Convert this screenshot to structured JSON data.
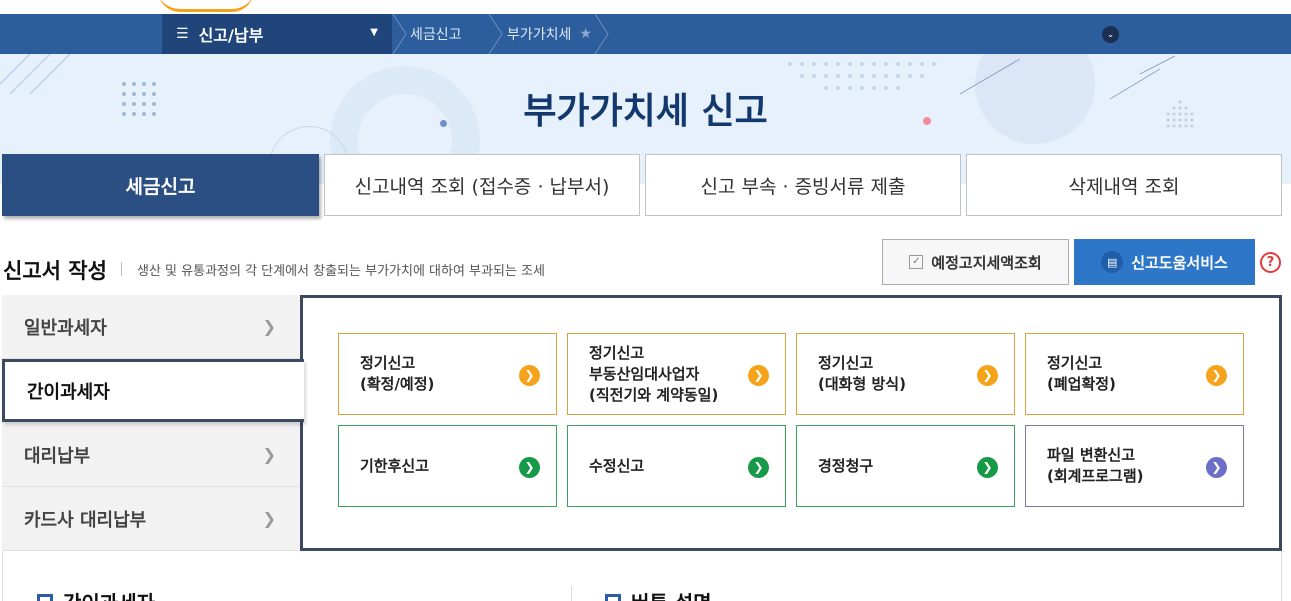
{
  "nav": {
    "menu_label": "신고/납부",
    "breadcrumb": [
      "세금신고",
      "부가가치세"
    ]
  },
  "hero": {
    "title": "부가가치세 신고"
  },
  "tabs": [
    {
      "label": "세금신고",
      "active": true
    },
    {
      "label": "신고내역 조회 (접수증 · 납부서)",
      "active": false
    },
    {
      "label": "신고 부속 · 증빙서류 제출",
      "active": false
    },
    {
      "label": "삭제내역 조회",
      "active": false
    }
  ],
  "section": {
    "title": "신고서 작성",
    "description": "생산 및 유통과정의 각 단계에서 창출되는 부가가치에 대하여 부과되는 조세",
    "btn_estimate": "예정고지세액조회",
    "btn_help_service": "신고도움서비스",
    "help_glyph": "?"
  },
  "side_menu": [
    {
      "label": "일반과세자",
      "active": false
    },
    {
      "label": "간이과세자",
      "active": true
    },
    {
      "label": "대리납부",
      "active": false
    },
    {
      "label": "카드사 대리납부",
      "active": false
    }
  ],
  "cards": [
    {
      "lines": [
        "정기신고",
        "(확정/예정)"
      ],
      "color": "orange"
    },
    {
      "lines": [
        "정기신고",
        "부동산임대사업자",
        "(직전기와 계약동일)"
      ],
      "color": "orange"
    },
    {
      "lines": [
        "정기신고",
        "(대화형 방식)"
      ],
      "color": "orange"
    },
    {
      "lines": [
        "정기신고",
        "(폐업확정)"
      ],
      "color": "orange"
    },
    {
      "lines": [
        "기한후신고"
      ],
      "color": "green"
    },
    {
      "lines": [
        "수정신고"
      ],
      "color": "green"
    },
    {
      "lines": [
        "경정청구"
      ],
      "color": "green"
    },
    {
      "lines": [
        "파일 변환신고",
        "(회계프로그램)"
      ],
      "color": "purple"
    }
  ],
  "bottom": {
    "left_heading": "간이과세자",
    "right_heading": "버튼 설명"
  },
  "colors": {
    "navbar": "#2c5e9e",
    "tab_active": "#2b4f82",
    "primary_button": "#2e77c8",
    "orange": "#f4a31b",
    "green": "#169a48",
    "purple": "#6b6fc8"
  }
}
